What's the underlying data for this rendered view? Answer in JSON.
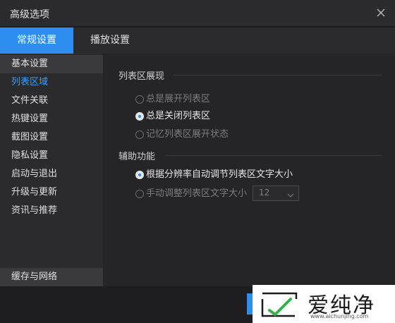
{
  "window": {
    "title": "高级选项"
  },
  "tabs": [
    {
      "label": "常规设置",
      "active": true
    },
    {
      "label": "播放设置",
      "active": false
    }
  ],
  "sidebar": {
    "items": [
      {
        "label": "基本设置"
      },
      {
        "label": "列表区域"
      },
      {
        "label": "文件关联"
      },
      {
        "label": "热键设置"
      },
      {
        "label": "截图设置"
      },
      {
        "label": "隐私设置"
      },
      {
        "label": "启动与退出"
      },
      {
        "label": "升级与更新"
      },
      {
        "label": "资讯与推荐"
      }
    ],
    "bottom_item": {
      "label": "缓存与网络"
    }
  },
  "content": {
    "section1": {
      "title": "列表区展现",
      "options": [
        {
          "label": "总是展开列表区",
          "checked": false
        },
        {
          "label": "总是关闭列表区",
          "checked": true
        },
        {
          "label": "记忆列表区展开状态",
          "checked": false
        }
      ]
    },
    "section2": {
      "title": "辅助功能",
      "options": [
        {
          "label": "根据分辨率自动调节列表区文字大小",
          "checked": true
        },
        {
          "label": "手动调整列表区文字大小",
          "checked": false
        }
      ],
      "font_size_select": {
        "value": "12"
      }
    }
  },
  "watermark": {
    "text": "爱纯净",
    "url": "www.aichunjing.com"
  },
  "colors": {
    "accent": "#2d8ef0",
    "link": "#3a9cf3"
  }
}
